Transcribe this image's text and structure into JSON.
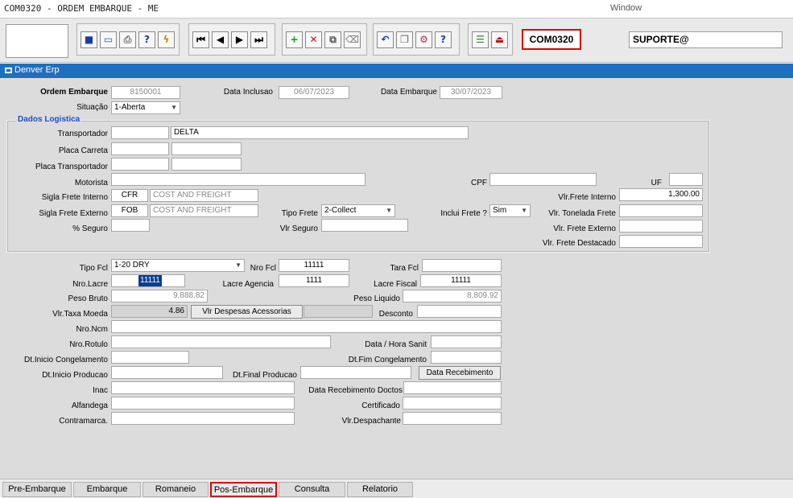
{
  "window": {
    "title": "COM0320 - ORDEM EMBARQUE - ME",
    "menu": "Window"
  },
  "toolbar": {
    "program_code": "COM0320",
    "user": "SUPORTE@"
  },
  "form_header": "Denver Erp",
  "fields": {
    "ordem_embarque": {
      "label": "Ordem Embarque",
      "value": "8150001"
    },
    "data_inclusao": {
      "label": "Data Inclusao",
      "value": "06/07/2023"
    },
    "data_embarque": {
      "label": "Data Embarque",
      "value": "30/07/2023"
    },
    "situacao": {
      "label": "Situação",
      "value": "1-Aberta"
    }
  },
  "logistica": {
    "title": "Dados Logistica",
    "transportador": {
      "label": "Transportador",
      "value": "DELTA"
    },
    "placa_carreta": {
      "label": "Placa Carreta"
    },
    "placa_transportador": {
      "label": "Placa Transportador"
    },
    "motorista": {
      "label": "Motorista"
    },
    "cpf": {
      "label": "CPF"
    },
    "uf": {
      "label": "UF"
    },
    "sigla_frete_interno": {
      "label": "Sigla Frete Interno",
      "code": "CFR",
      "desc": "COST AND FREIGHT"
    },
    "sigla_frete_externo": {
      "label": "Sigla Frete Externo",
      "code": "FOB",
      "desc": "COST AND FREIGHT"
    },
    "vlr_frete_interno": {
      "label": "Vlr.Frete Interno",
      "value": "1,300.00"
    },
    "tipo_frete": {
      "label": "Tipo Frete",
      "value": "2-Collect"
    },
    "inclui_frete": {
      "label": "Inclui Frete ?",
      "value": "Sim"
    },
    "vlr_tonelada_frete": {
      "label": "Vlr. Tonelada Frete"
    },
    "seguro": {
      "label": "% Seguro"
    },
    "vlr_seguro": {
      "label": "Vlr Seguro"
    },
    "vlr_frete_externo": {
      "label": "Vlr. Frete Externo"
    },
    "vlr_frete_destacado": {
      "label": "Vlr. Frete Destacado"
    }
  },
  "embarque": {
    "tipo_fcl": {
      "label": "Tipo Fcl",
      "value": "1-20 DRY"
    },
    "nro_fcl": {
      "label": "Nro Fcl",
      "value": "11111"
    },
    "tara_fcl": {
      "label": "Tara Fcl"
    },
    "nro_lacre": {
      "label": "Nro.Lacre",
      "value": "11111"
    },
    "lacre_agencia": {
      "label": "Lacre Agencia",
      "value": "1111"
    },
    "lacre_fiscal": {
      "label": "Lacre Fiscal",
      "value": "11111"
    },
    "peso_bruto": {
      "label": "Peso Bruto",
      "value": "9,888.82"
    },
    "peso_liquido": {
      "label": "Peso Liquido",
      "value": "8,809.92"
    },
    "vlr_taxa_moeda": {
      "label": "Vlr.Taxa Moeda",
      "value": "4.86"
    },
    "vlr_despesas": {
      "label": "Vlr Despesas Acessorias"
    },
    "desconto": {
      "label": "Desconto"
    },
    "nro_ncm": {
      "label": "Nro.Ncm"
    },
    "nro_rotulo": {
      "label": "Nro.Rotulo"
    },
    "data_hora_sanit": {
      "label": "Data / Hora Sanit"
    },
    "dt_inicio_congelamento": {
      "label": "Dt.Inicio Congelamento"
    },
    "dt_fim_congelamento": {
      "label": "Dt.Fim Congelamento"
    },
    "dt_inicio_producao": {
      "label": "Dt.Inicio Producao"
    },
    "dt_final_producao": {
      "label": "Dt.Final Producao"
    },
    "data_recebimento_btn": "Data Recebimento",
    "inac": {
      "label": "Inac"
    },
    "data_recebimento_doctos": {
      "label": "Data Recebimento Doctos"
    },
    "alfandega": {
      "label": "Alfandega"
    },
    "certificado": {
      "label": "Certificado"
    },
    "contramarca": {
      "label": "Contramarca."
    },
    "vlr_despachante": {
      "label": "Vlr.Despachante"
    }
  },
  "tabs": [
    "Pre-Embarque",
    "Embarque",
    "Romaneio",
    "Pos-Embarque",
    "Consulta",
    "Relatorio"
  ],
  "active_tab": "Pos-Embarque",
  "colors": {
    "header_blue": "#1e6fbf",
    "highlight_red": "#e00000",
    "group_title_blue": "#1f4fc0"
  }
}
